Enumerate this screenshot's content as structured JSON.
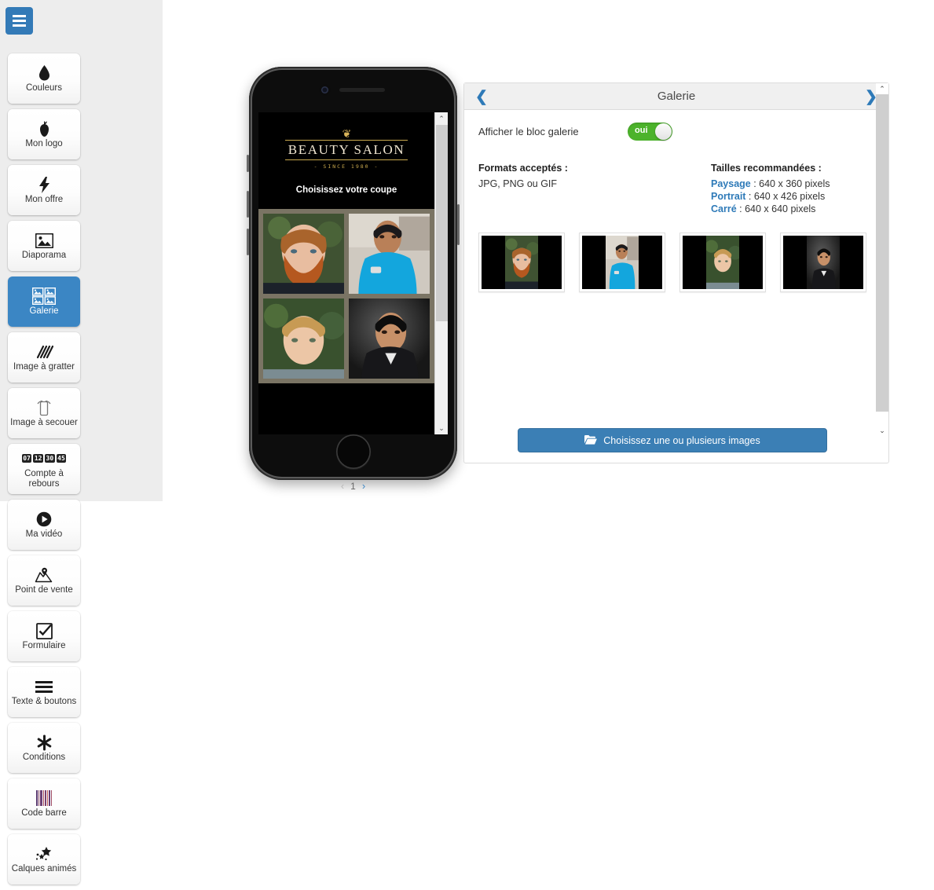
{
  "sidebar": {
    "menu_button": "menu-icon",
    "tiles": [
      {
        "label": "Couleurs",
        "icon": "droplet-icon",
        "active": false
      },
      {
        "label": "Mon logo",
        "icon": "apple-icon",
        "active": false
      },
      {
        "label": "Mon offre",
        "icon": "bolt-icon",
        "active": false
      },
      {
        "label": "Diaporama",
        "icon": "picture-icon",
        "active": false
      },
      {
        "label": "Galerie",
        "icon": "gallery-icon",
        "active": true
      },
      {
        "label": "Image à gratter",
        "icon": "scratch-icon",
        "active": false
      },
      {
        "label": "Image à secouer",
        "icon": "shake-icon",
        "active": false
      },
      {
        "label": "Compte à rebours",
        "icon": "countdown-icon",
        "active": false
      },
      {
        "label": "Ma vidéo",
        "icon": "play-icon",
        "active": false
      },
      {
        "label": "Point de vente",
        "icon": "map-pin-icon",
        "active": false
      },
      {
        "label": "Formulaire",
        "icon": "checkbox-icon",
        "active": false
      },
      {
        "label": "Texte & boutons",
        "icon": "lines-icon",
        "active": false
      },
      {
        "label": "Conditions",
        "icon": "asterisk-icon",
        "active": false
      },
      {
        "label": "Code barre",
        "icon": "barcode-icon",
        "active": false
      },
      {
        "label": "Calques animés",
        "icon": "stars-icon",
        "active": false
      }
    ],
    "countdown_digits": [
      "07",
      "12",
      "30",
      "45"
    ]
  },
  "preview": {
    "logo_ornament": "❦",
    "logo_main": "BEAUTY SALON",
    "logo_sub": "- SINCE 1980 -",
    "heading": "Choisissez votre coupe",
    "photos": [
      {
        "name": "bearded-red-hair-man"
      },
      {
        "name": "man-blue-polo"
      },
      {
        "name": "blond-curly-man"
      },
      {
        "name": "man-leather-jacket"
      }
    ],
    "pager": {
      "prev": "‹",
      "page": "1",
      "next": "›"
    }
  },
  "panel": {
    "title": "Galerie",
    "nav_prev": "❮",
    "nav_next": "❯",
    "toggle": {
      "label": "Afficher le bloc galerie",
      "value": "oui",
      "on": true
    },
    "formats": {
      "heading": "Formats acceptés :",
      "text": "JPG, PNG ou GIF"
    },
    "sizes": {
      "heading": "Tailles recommandées :",
      "items": [
        {
          "key": "Paysage",
          "value": " : 640 x 360 pixels"
        },
        {
          "key": "Portrait",
          "value": " : 640 x 426 pixels"
        },
        {
          "key": "Carré",
          "value": " : 640 x 640 pixels"
        }
      ]
    },
    "thumbnails": [
      {
        "name": "thumb-bearded-red-hair"
      },
      {
        "name": "thumb-blue-polo"
      },
      {
        "name": "thumb-blond-curly"
      },
      {
        "name": "thumb-leather-jacket"
      }
    ],
    "choose_button": {
      "label": "Choisissez une ou plusieurs images",
      "icon": "folder-open-icon"
    }
  },
  "colors": {
    "accent_blue": "#3b86c4",
    "toggle_green": "#4cb32b",
    "link_blue": "#2e7ab8",
    "sidebar_bg": "#ededed",
    "button_blue": "#3b7fb5"
  }
}
